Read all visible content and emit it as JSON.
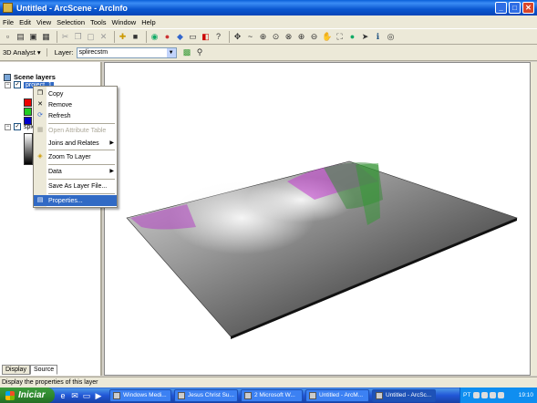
{
  "window": {
    "title": "Untitled - ArcScene - ArcInfo",
    "buttons": [
      "_",
      "□",
      "✕"
    ]
  },
  "menubar": [
    "File",
    "Edit",
    "View",
    "Selection",
    "Tools",
    "Window",
    "Help"
  ],
  "toolbar2": {
    "analyst": "3D Analyst ▾",
    "layer_label": "Layer:",
    "layer_value": "splirecstm"
  },
  "toc": {
    "root": "Scene layers",
    "layer1": "project_1",
    "layer2": "sple",
    "tabs": [
      "Display",
      "Source"
    ]
  },
  "context_menu": {
    "items": [
      {
        "label": "Copy",
        "icon": "copy-icon"
      },
      {
        "label": "Remove",
        "icon": "remove-icon"
      },
      {
        "label": "Refresh",
        "icon": "refresh-icon"
      },
      {
        "label": "Open Attribute Table",
        "icon": "table-icon",
        "disabled": true
      },
      {
        "label": "Joins and Relates",
        "submenu": true
      },
      {
        "label": "Zoom To Layer",
        "icon": "zoom-layer-icon"
      },
      {
        "label": "Data",
        "submenu": true
      },
      {
        "label": "Save As Layer File...",
        "icon": ""
      },
      {
        "label": "Properties...",
        "icon": "properties-icon",
        "highlighted": true
      }
    ]
  },
  "statusbar": "Display the properties of this layer",
  "taskbar": {
    "start": "Iniciar",
    "tasks": [
      "Windows Medi...",
      "Jesus Christ Su...",
      "2 Microsoft W...",
      "Untitled - ArcM...",
      "Untitled - ArcSc..."
    ],
    "lang": "PT",
    "clock": "19:10"
  },
  "colors": {
    "highlight": "#316ac5",
    "title_bar": "#0a5fd8",
    "taskbar": "#2157d7"
  }
}
